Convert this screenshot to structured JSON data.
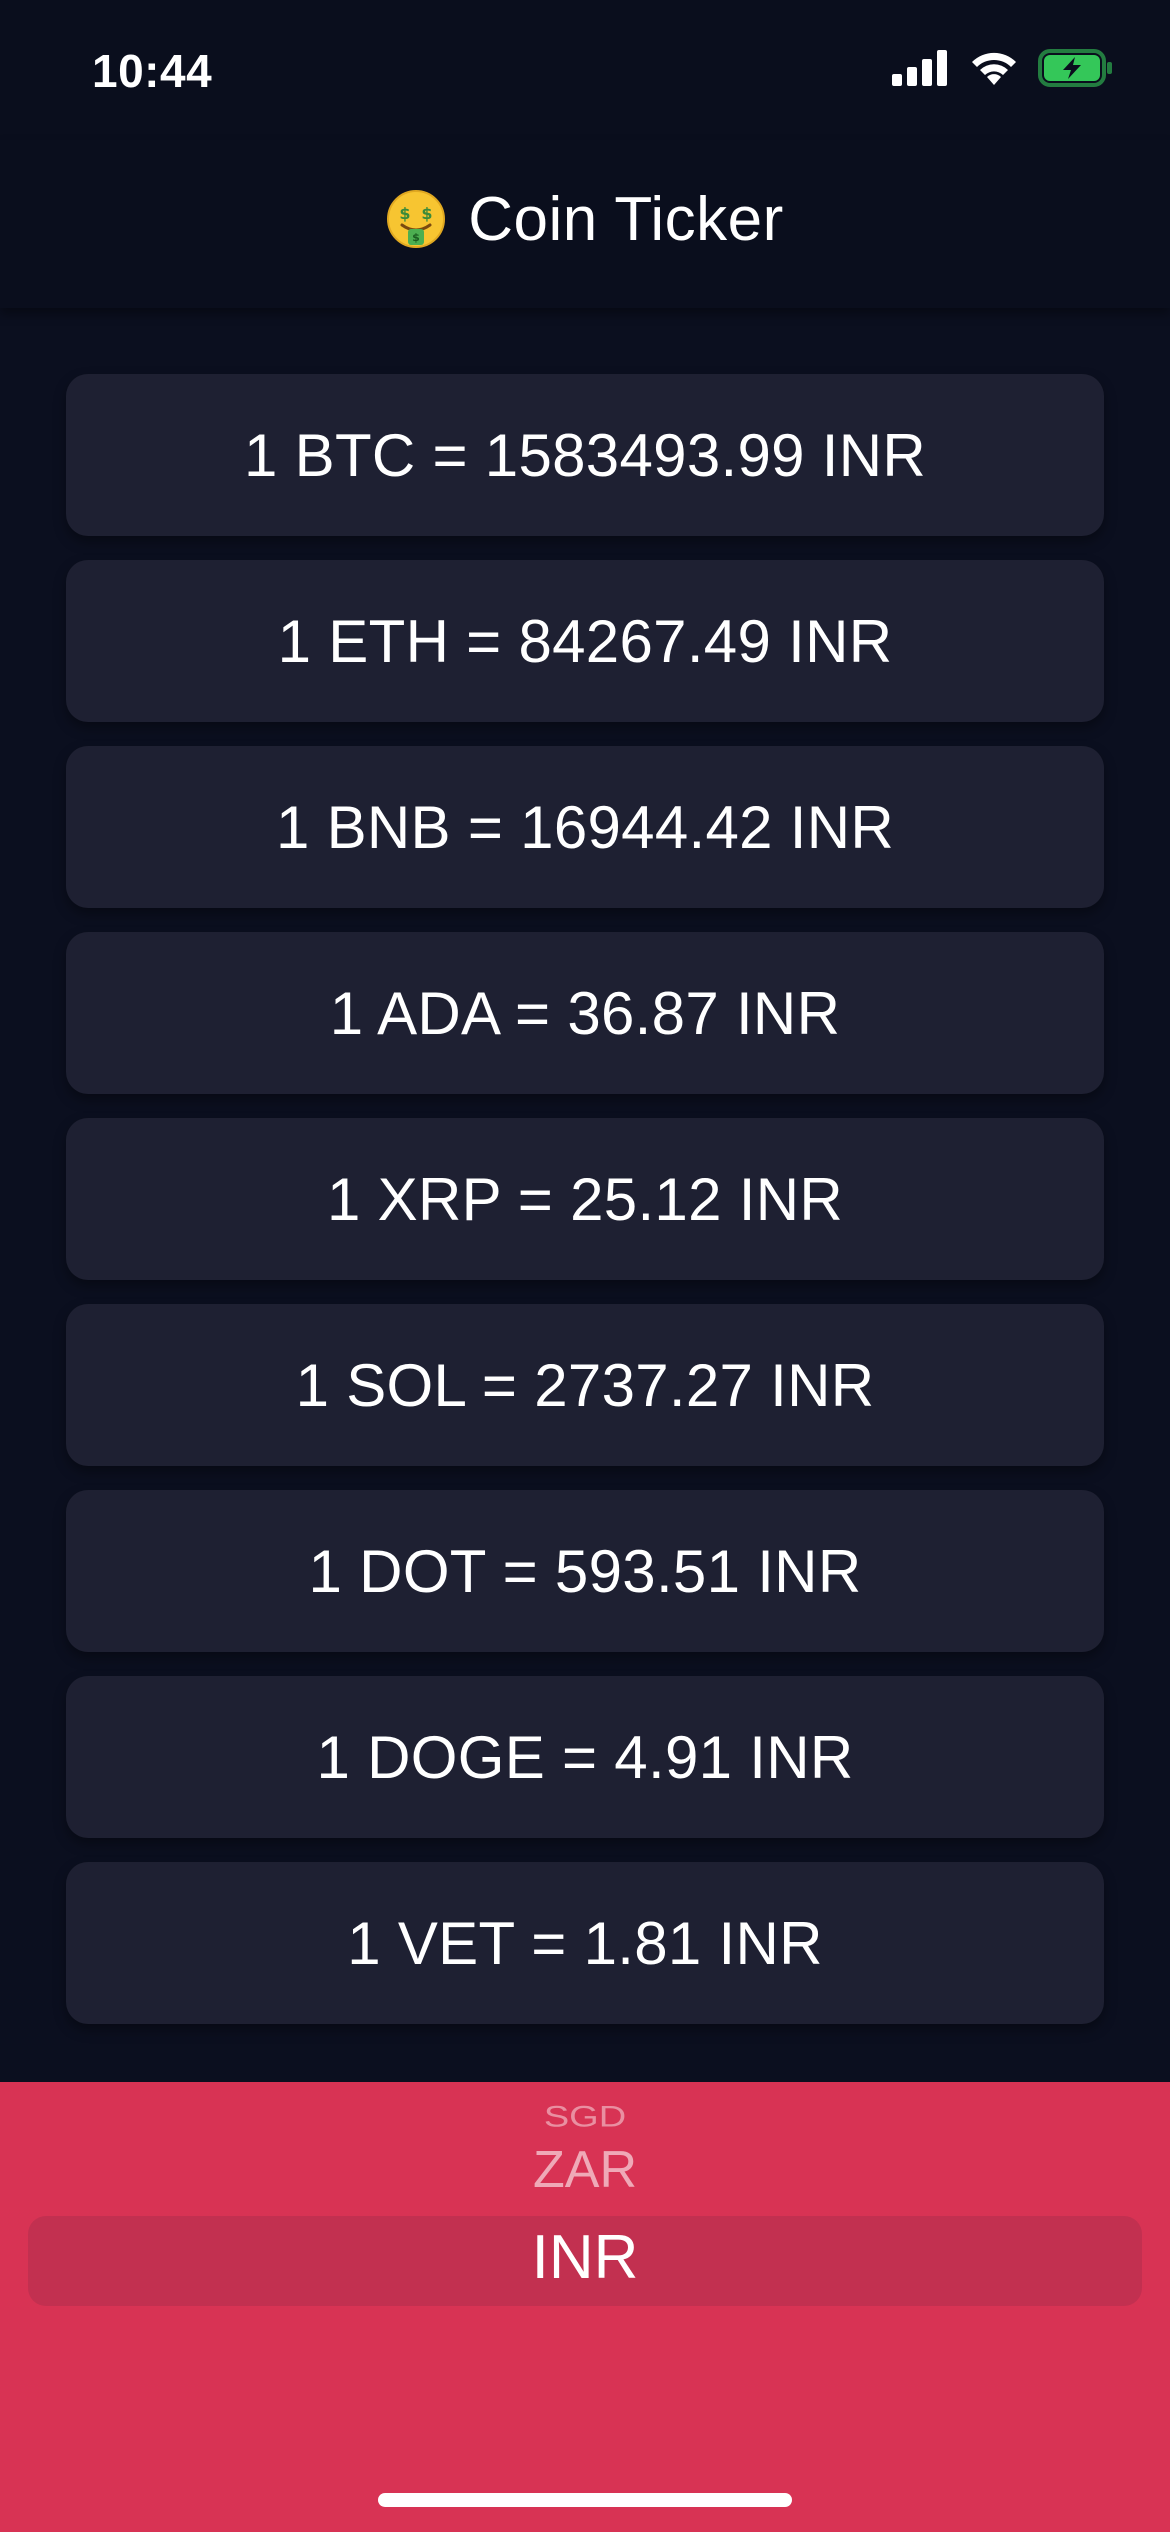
{
  "status_bar": {
    "time": "10:44",
    "icons": [
      "cellular-signal-icon",
      "wifi-icon",
      "battery-charging-icon"
    ],
    "battery_color": "#34c759"
  },
  "header": {
    "emoji_icon": "money-mouth-face-icon",
    "title": "Coin Ticker"
  },
  "rates": [
    {
      "text": "1 BTC = 1583493.99 INR"
    },
    {
      "text": "1 ETH = 84267.49 INR"
    },
    {
      "text": "1 BNB = 16944.42 INR"
    },
    {
      "text": "1 ADA = 36.87 INR"
    },
    {
      "text": "1 XRP = 25.12 INR"
    },
    {
      "text": "1 SOL = 2737.27 INR"
    },
    {
      "text": "1 DOT = 593.51 INR"
    },
    {
      "text": "1 DOGE = 4.91 INR"
    },
    {
      "text": "1 VET = 1.81 INR"
    }
  ],
  "currency_picker": {
    "options_above": [
      "SGD",
      "ZAR"
    ],
    "selected": "INR",
    "background_color": "#d83354"
  },
  "colors": {
    "background": "#0b0f1f",
    "card": "#1e2032",
    "accent": "#d83354"
  }
}
